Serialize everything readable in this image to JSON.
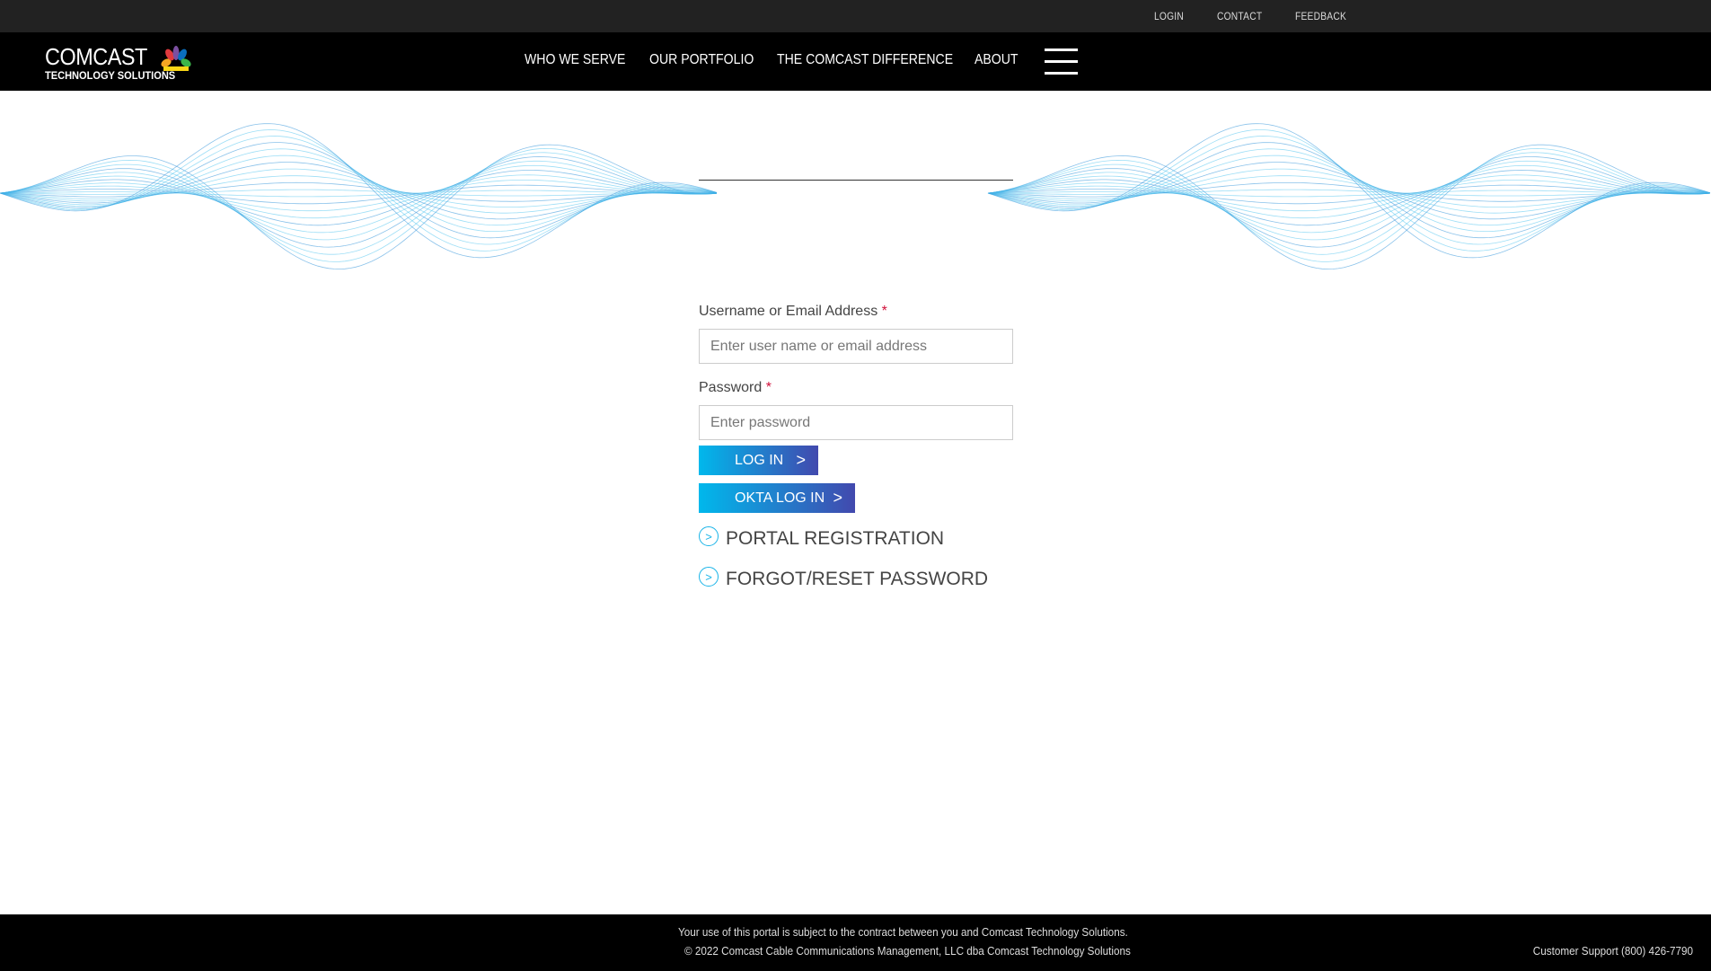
{
  "topbar": {
    "links": [
      "LOGIN",
      "CONTACT",
      "FEEDBACK"
    ]
  },
  "logo": {
    "line1": "COMCAST",
    "line2": "TECHNOLOGY SOLUTIONS"
  },
  "nav": {
    "items": [
      "WHO WE SERVE",
      "OUR PORTFOLIO",
      "THE COMCAST DIFFERENCE",
      "ABOUT"
    ]
  },
  "form": {
    "username_label": "Username or Email Address",
    "username_placeholder": "Enter user name or email address",
    "password_label": "Password",
    "password_placeholder": "Enter password",
    "required": "*",
    "login_label": "LOG IN",
    "okta_label": "OKTA LOG IN",
    "chevron": ">",
    "portal_registration": "PORTAL REGISTRATION",
    "forgot_password": "FORGOT/RESET PASSWORD"
  },
  "footer": {
    "terms": "Your use of this portal is subject to the contract between you and Comcast Technology Solutions.",
    "copyright": "© 2022 Comcast Cable Communications Management, LLC dba Comcast Technology Solutions",
    "support": "Customer Support (800) 426-7790"
  },
  "colors": {
    "accent": "#00b8ec",
    "accent2": "#4249ae",
    "required": "#d0103a"
  }
}
